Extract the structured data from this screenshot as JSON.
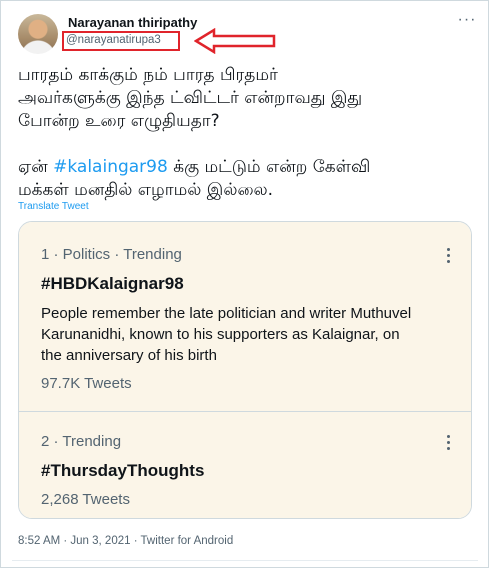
{
  "author": {
    "display_name": "Narayanan thiripathy",
    "handle": "@narayanatirupa3"
  },
  "icons": {
    "more": "more-horizontal-icon",
    "annotation_arrow": "red-arrow-left-icon",
    "highlight_color": "#e0242b"
  },
  "tweet": {
    "lines": [
      "பாரதம் காக்கும் நம் பாரத பிரதமர்",
      "அவர்களுக்கு இந்த ட்விட்டர் என்றாவது இது",
      "போன்ற உரை எழுதியதா?"
    ],
    "line4_prefix": "ஏன் ",
    "hashtag": "#kalaingar98",
    "line4_suffix": " க்கு மட்டும் என்ற  கேள்வி",
    "line5": "மக்கள் மனதில் எழாமல் இல்லை.",
    "translate_label": "Translate Tweet",
    "hashtag_color": "#1d9bf0"
  },
  "trends": [
    {
      "meta": "1 · Politics · Trending",
      "title": "#HBDKalaignar98",
      "description_lines": [
        "People remember the late politician and writer Muthuvel",
        "Karunanidhi, known to his supporters as Kalaignar, on",
        "the anniversary of his birth"
      ],
      "count": "97.7K Tweets"
    },
    {
      "meta": "2 · Trending",
      "title": "#ThursdayThoughts",
      "count": "2,268 Tweets"
    }
  ],
  "footer": {
    "timestamp": "8:52 AM · Jun 3, 2021 · Twitter for Android"
  }
}
